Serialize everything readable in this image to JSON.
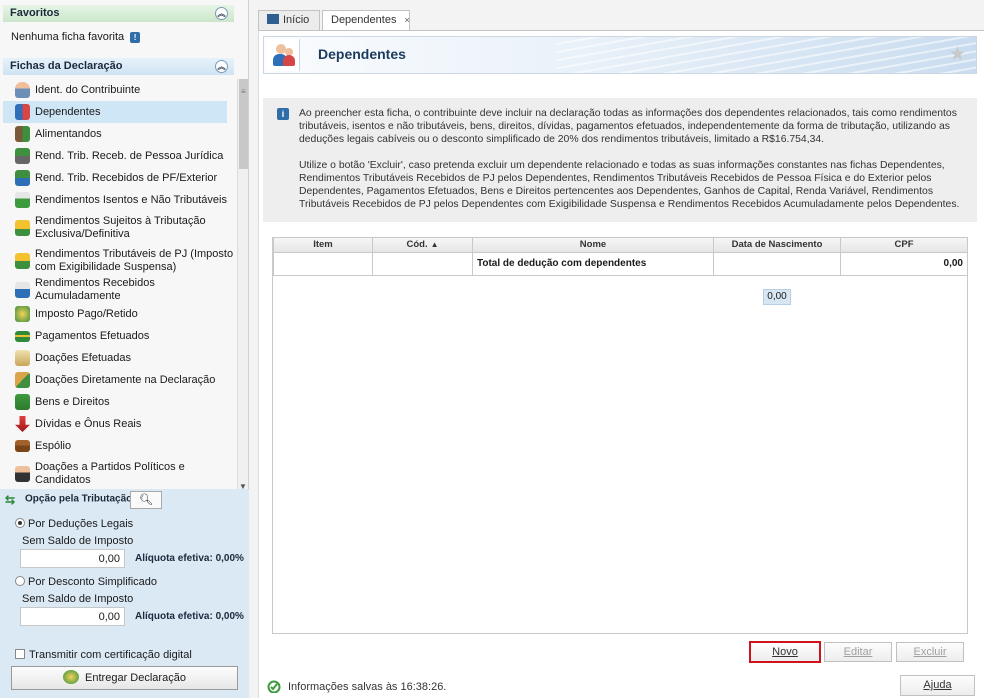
{
  "sidebar": {
    "favoritos_title": "Favoritos",
    "no_favorites": "Nenhuma ficha favorita",
    "fichas_title": "Fichas da Declaração",
    "items": [
      {
        "label": "Ident. do Contribuinte",
        "icon": "person-icon"
      },
      {
        "label": "Dependentes",
        "icon": "dependents-icon"
      },
      {
        "label": "Alimentandos",
        "icon": "alimentandos-icon"
      },
      {
        "label": "Rend. Trib. Receb. de Pessoa Jurídica",
        "icon": "money-pj-icon"
      },
      {
        "label": "Rend. Trib. Recebidos de PF/Exterior",
        "icon": "money-pf-icon"
      },
      {
        "label": "Rendimentos Isentos e Não Tributáveis",
        "icon": "check-money-icon"
      },
      {
        "label": "Rendimentos Sujeitos à Tributação Exclusiva/Definitiva",
        "icon": "warning-money-icon"
      },
      {
        "label": "Rendimentos Tributáveis de PJ (Imposto com Exigibilidade Suspensa)",
        "icon": "money-suspended-icon"
      },
      {
        "label": "Rendimentos Recebidos Acumuladamente",
        "icon": "money-accumulated-icon"
      },
      {
        "label": "Imposto Pago/Retido",
        "icon": "tax-paid-icon"
      },
      {
        "label": "Pagamentos Efetuados",
        "icon": "card-icon"
      },
      {
        "label": "Doações Efetuadas",
        "icon": "donation-icon"
      },
      {
        "label": "Doações Diretamente na Declaração",
        "icon": "donation-direct-icon"
      },
      {
        "label": "Bens e Direitos",
        "icon": "assets-icon"
      },
      {
        "label": "Dívidas e Ônus Reais",
        "icon": "debt-arrow-icon"
      },
      {
        "label": "Espólio",
        "icon": "chest-icon"
      },
      {
        "label": "Doações a Partidos Políticos e Candidatos",
        "icon": "political-donation-icon"
      }
    ],
    "opcao": {
      "title": "Opção pela Tributação:",
      "deducoes_label": "Por Deduções Legais",
      "deducoes_saldo": "Sem Saldo de Imposto",
      "deducoes_valor": "0,00",
      "deducoes_aliquota": "Alíquota efetiva: 0,00%",
      "simplificado_label": "Por Desconto Simplificado",
      "simplificado_saldo": "Sem Saldo de Imposto",
      "simplificado_valor": "0,00",
      "simplificado_aliquota": "Alíquota efetiva: 0,00%",
      "transmitir_label": "Transmitir com certificação digital",
      "entregar_label": "Entregar Declaração"
    }
  },
  "tabs": {
    "inicio": "Início",
    "dependentes": "Dependentes",
    "close": "×"
  },
  "page": {
    "title": "Dependentes",
    "info_p1": "Ao preencher esta ficha, o contribuinte deve incluir na declaração todas as informações dos dependentes relacionados, tais como rendimentos tributáveis, isentos e não tributáveis, bens, direitos, dívidas, pagamentos efetuados, independentemente da forma de tributação, utilizando as deduções legais cabíveis ou o desconto simplificado de 20% dos rendimentos tributáveis, limitado a R$16.754,34.",
    "info_p2": "Utilize o botão 'Excluir', caso pretenda excluir um dependente relacionado e todas as suas informações constantes nas fichas Dependentes, Rendimentos Tributáveis Recebidos de PJ pelos Dependentes, Rendimentos Tributáveis Recebidos de Pessoa Física e do Exterior pelos Dependentes, Pagamentos Efetuados, Bens e Direitos pertencentes aos Dependentes, Ganhos de Capital, Renda Variável, Rendimentos Tributáveis Recebidos de PJ pelos Dependentes com Exigibilidade Suspensa e Rendimentos Recebidos Acumuladamente pelos Dependentes."
  },
  "table": {
    "columns": [
      "Item",
      "Cód.",
      "Nome",
      "Data de Nascimento",
      "CPF"
    ],
    "total_label": "Total de dedução com dependentes",
    "total_value": "0,00",
    "sum_value": "0,00"
  },
  "buttons": {
    "novo": "Novo",
    "editar": "Editar",
    "excluir": "Excluir",
    "ajuda": "Ajuda"
  },
  "status": {
    "text": "Informações salvas às 16:38:26."
  },
  "colors": {
    "highlight": "#d0131b",
    "selected": "#cfe6f7",
    "panel": "#dbe9f5"
  }
}
